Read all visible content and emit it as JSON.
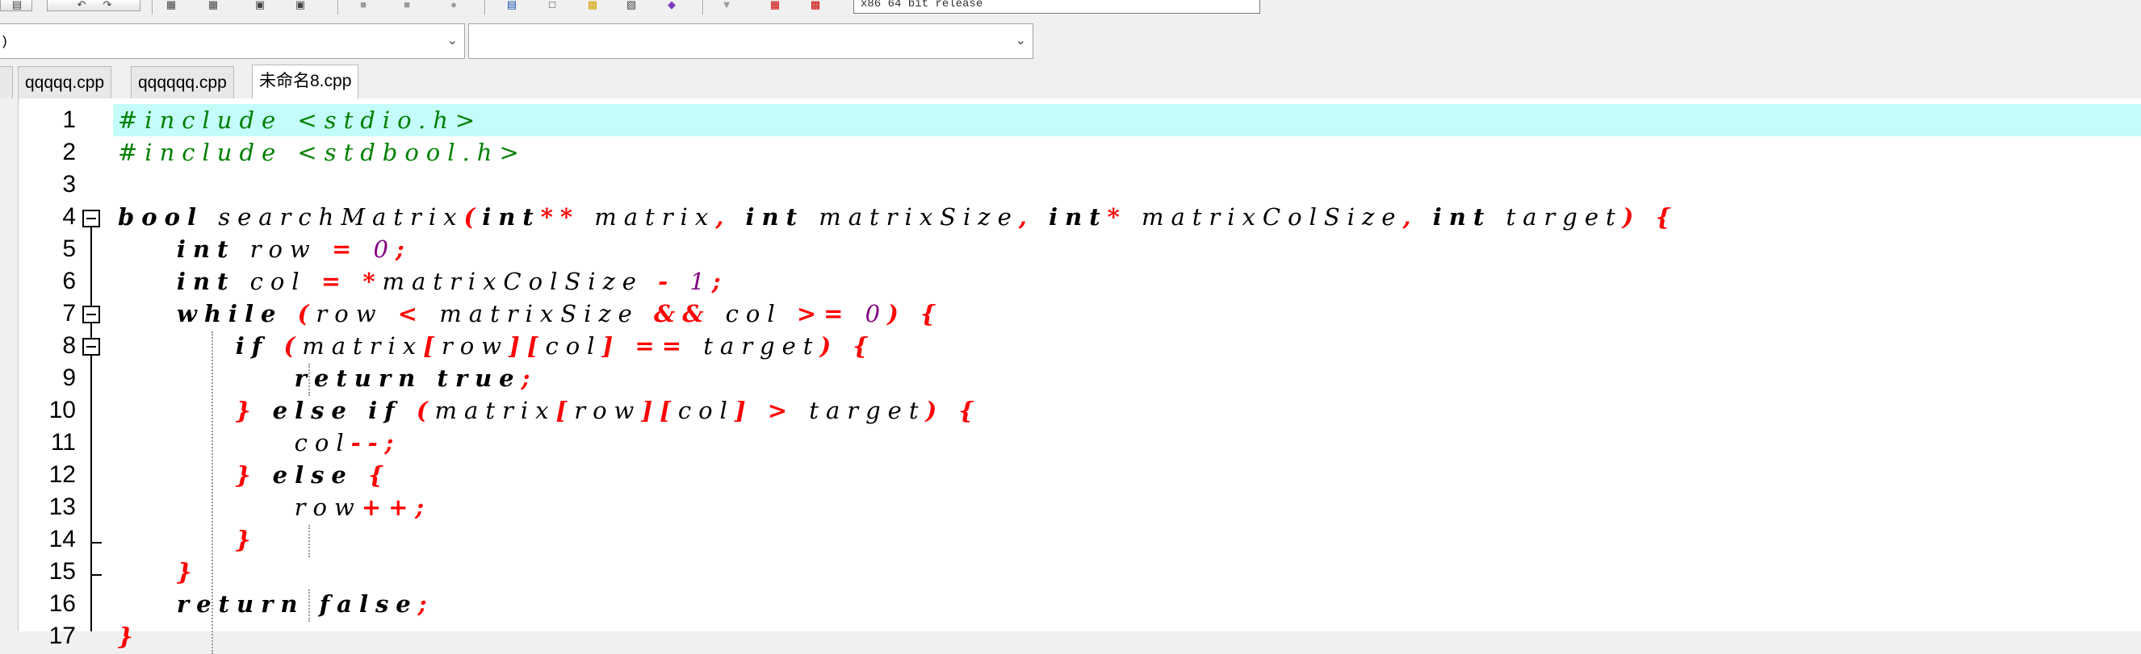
{
  "toolbar": {
    "icons": [
      "unknown-icon",
      "undo-icon",
      "redo-icon",
      "compile-icon",
      "run-icon",
      "compile-run-icon",
      "rebuild-icon",
      "debug-icon",
      "stop-icon",
      "insert-icon",
      "chart-icon",
      "profile-icon",
      "check-icon",
      "dropdown-icon",
      "grid-icon",
      "color-icon"
    ],
    "combo_value": "x86 64 bit release"
  },
  "selectors": {
    "left_value": ")",
    "right_value": ""
  },
  "tabs": [
    {
      "label": "qqqqq.cpp",
      "active": false
    },
    {
      "label": "qqqqqq.cpp",
      "active": false
    },
    {
      "label": "未命名8.cpp",
      "active": true
    }
  ],
  "editor": {
    "line_numbers": [
      "1",
      "2",
      "3",
      "4",
      "5",
      "6",
      "7",
      "8",
      "9",
      "10",
      "11",
      "12",
      "13",
      "14",
      "15",
      "16",
      "17"
    ],
    "highlighted_line": 1,
    "lines": [
      [
        {
          "t": "#include <stdio.h>",
          "c": "pp"
        }
      ],
      [
        {
          "t": "#include <stdbool.h>",
          "c": "pp"
        }
      ],
      [],
      [
        {
          "t": "bool",
          "c": "k"
        },
        {
          "t": " searchMatrix",
          "c": ""
        },
        {
          "t": "(",
          "c": "p"
        },
        {
          "t": "int",
          "c": "k"
        },
        {
          "t": "**",
          "c": "p"
        },
        {
          "t": " matrix",
          "c": ""
        },
        {
          "t": ",",
          "c": "p"
        },
        {
          "t": " ",
          "c": ""
        },
        {
          "t": "int",
          "c": "k"
        },
        {
          "t": " matrixSize",
          "c": ""
        },
        {
          "t": ",",
          "c": "p"
        },
        {
          "t": " ",
          "c": ""
        },
        {
          "t": "int",
          "c": "k"
        },
        {
          "t": "*",
          "c": "p"
        },
        {
          "t": " matrixColSize",
          "c": ""
        },
        {
          "t": ",",
          "c": "p"
        },
        {
          "t": " ",
          "c": ""
        },
        {
          "t": "int",
          "c": "k"
        },
        {
          "t": " target",
          "c": ""
        },
        {
          "t": ")",
          "c": "p"
        },
        {
          "t": " ",
          "c": ""
        },
        {
          "t": "{",
          "c": "p"
        }
      ],
      [
        {
          "t": "    ",
          "c": ""
        },
        {
          "t": "int",
          "c": "k"
        },
        {
          "t": " row ",
          "c": ""
        },
        {
          "t": "=",
          "c": "p"
        },
        {
          "t": " ",
          "c": ""
        },
        {
          "t": "0",
          "c": "n"
        },
        {
          "t": ";",
          "c": "p"
        }
      ],
      [
        {
          "t": "    ",
          "c": ""
        },
        {
          "t": "int",
          "c": "k"
        },
        {
          "t": " col ",
          "c": ""
        },
        {
          "t": "=",
          "c": "p"
        },
        {
          "t": " ",
          "c": ""
        },
        {
          "t": "*",
          "c": "p"
        },
        {
          "t": "matrixColSize ",
          "c": ""
        },
        {
          "t": "-",
          "c": "p"
        },
        {
          "t": " ",
          "c": ""
        },
        {
          "t": "1",
          "c": "n"
        },
        {
          "t": ";",
          "c": "p"
        }
      ],
      [
        {
          "t": "    ",
          "c": ""
        },
        {
          "t": "while",
          "c": "k"
        },
        {
          "t": " ",
          "c": ""
        },
        {
          "t": "(",
          "c": "p"
        },
        {
          "t": "row ",
          "c": ""
        },
        {
          "t": "<",
          "c": "p"
        },
        {
          "t": " matrixSize ",
          "c": ""
        },
        {
          "t": "&&",
          "c": "p"
        },
        {
          "t": " col ",
          "c": ""
        },
        {
          "t": ">=",
          "c": "p"
        },
        {
          "t": " ",
          "c": ""
        },
        {
          "t": "0",
          "c": "n"
        },
        {
          "t": ")",
          "c": "p"
        },
        {
          "t": " ",
          "c": ""
        },
        {
          "t": "{",
          "c": "p"
        }
      ],
      [
        {
          "t": "        ",
          "c": ""
        },
        {
          "t": "if",
          "c": "k"
        },
        {
          "t": " ",
          "c": ""
        },
        {
          "t": "(",
          "c": "p"
        },
        {
          "t": "matrix",
          "c": ""
        },
        {
          "t": "[",
          "c": "p"
        },
        {
          "t": "row",
          "c": ""
        },
        {
          "t": "][",
          "c": "p"
        },
        {
          "t": "col",
          "c": ""
        },
        {
          "t": "]",
          "c": "p"
        },
        {
          "t": " ",
          "c": ""
        },
        {
          "t": "==",
          "c": "p"
        },
        {
          "t": " target",
          "c": ""
        },
        {
          "t": ")",
          "c": "p"
        },
        {
          "t": " ",
          "c": ""
        },
        {
          "t": "{",
          "c": "p"
        }
      ],
      [
        {
          "t": "            ",
          "c": ""
        },
        {
          "t": "return",
          "c": "k"
        },
        {
          "t": " ",
          "c": ""
        },
        {
          "t": "true",
          "c": "k"
        },
        {
          "t": ";",
          "c": "p"
        }
      ],
      [
        {
          "t": "        ",
          "c": ""
        },
        {
          "t": "}",
          "c": "p"
        },
        {
          "t": " ",
          "c": ""
        },
        {
          "t": "else",
          "c": "k"
        },
        {
          "t": " ",
          "c": ""
        },
        {
          "t": "if",
          "c": "k"
        },
        {
          "t": " ",
          "c": ""
        },
        {
          "t": "(",
          "c": "p"
        },
        {
          "t": "matrix",
          "c": ""
        },
        {
          "t": "[",
          "c": "p"
        },
        {
          "t": "row",
          "c": ""
        },
        {
          "t": "][",
          "c": "p"
        },
        {
          "t": "col",
          "c": ""
        },
        {
          "t": "]",
          "c": "p"
        },
        {
          "t": " ",
          "c": ""
        },
        {
          "t": ">",
          "c": "p"
        },
        {
          "t": " target",
          "c": ""
        },
        {
          "t": ")",
          "c": "p"
        },
        {
          "t": " ",
          "c": ""
        },
        {
          "t": "{",
          "c": "p"
        }
      ],
      [
        {
          "t": "            col",
          "c": ""
        },
        {
          "t": "--;",
          "c": "p"
        }
      ],
      [
        {
          "t": "        ",
          "c": ""
        },
        {
          "t": "}",
          "c": "p"
        },
        {
          "t": " ",
          "c": ""
        },
        {
          "t": "else",
          "c": "k"
        },
        {
          "t": " ",
          "c": ""
        },
        {
          "t": "{",
          "c": "p"
        }
      ],
      [
        {
          "t": "            row",
          "c": ""
        },
        {
          "t": "++;",
          "c": "p"
        }
      ],
      [
        {
          "t": "        ",
          "c": ""
        },
        {
          "t": "}",
          "c": "p"
        }
      ],
      [
        {
          "t": "    ",
          "c": ""
        },
        {
          "t": "}",
          "c": "p"
        }
      ],
      [
        {
          "t": "    ",
          "c": ""
        },
        {
          "t": "return",
          "c": "k"
        },
        {
          "t": " ",
          "c": ""
        },
        {
          "t": "false",
          "c": "k"
        },
        {
          "t": ";",
          "c": "p"
        }
      ],
      [
        {
          "t": "}",
          "c": "p"
        }
      ]
    ]
  }
}
